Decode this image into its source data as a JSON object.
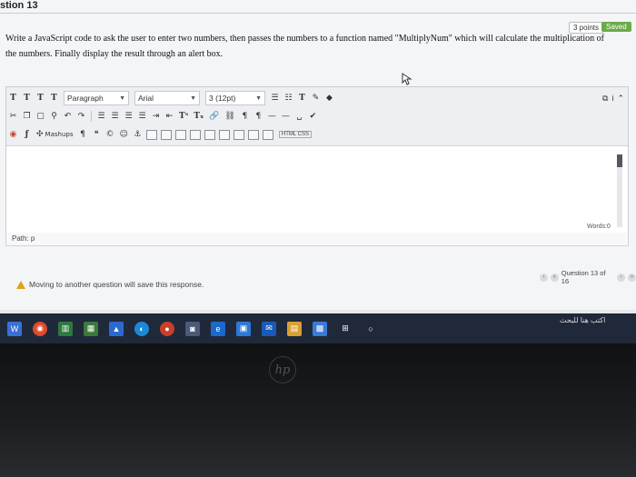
{
  "header": {
    "question_title": "stion 13"
  },
  "status": {
    "points": "3 points",
    "saved": "Saved"
  },
  "question": {
    "prompt": "Write a JavaScript code to ask the user to enter two numbers, then passes the numbers to a function named \"MultiplyNum\" which will calculate the multiplication of the numbers. Finally display the result through an alert box."
  },
  "toolbar": {
    "row1_buttons": [
      "T",
      "T",
      "T",
      "T"
    ],
    "paragraph": "Paragraph",
    "font": "Arial",
    "size": "3 (12pt)",
    "mashups": "Mashups",
    "html_css": "HTML CSS"
  },
  "editor": {
    "words": "Words:0",
    "path": "Path: p"
  },
  "footer": {
    "warning": "Moving to another question will save this response.",
    "question_nav": "Question 13 of 16"
  },
  "taskbar": {
    "search_text": "اكتب هنا للبحث"
  },
  "colors": {
    "saved_badge": "#6aab47",
    "warning": "#e0a020",
    "taskbar": "#20293a"
  }
}
